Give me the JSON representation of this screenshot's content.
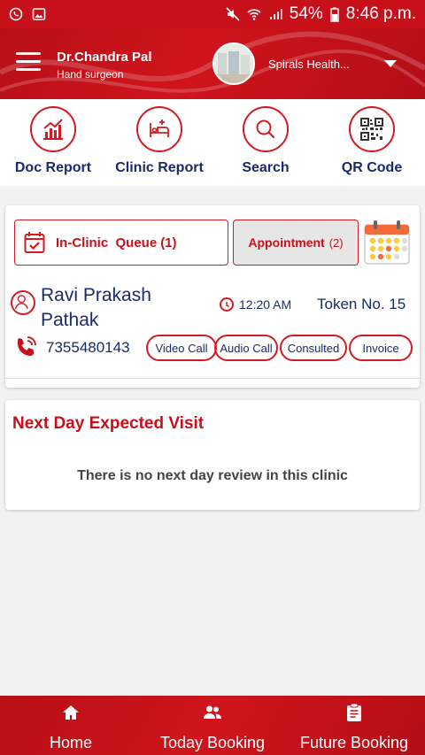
{
  "status_bar": {
    "battery": "54%",
    "time": "8:46 p.m."
  },
  "header": {
    "doctor_name": "Dr.Chandra Pal",
    "doctor_specialty": "Hand surgeon",
    "clinic_name": "Spirals Health..."
  },
  "quick_actions": [
    {
      "label": "Doc Report",
      "icon": "chart-icon"
    },
    {
      "label": "Clinic Report",
      "icon": "bed-icon"
    },
    {
      "label": "Search",
      "icon": "search-icon"
    },
    {
      "label": "QR Code",
      "icon": "qr-code-icon"
    }
  ],
  "queue": {
    "inclinic_label": "In-Clinic  Queue",
    "inclinic_count": "(1)",
    "appointment_label": "Appointment",
    "appointment_count": "(2)",
    "patient": {
      "name": "Ravi Prakash Pathak",
      "time": "12:20 AM",
      "token": "Token No. 15",
      "phone": "7355480143"
    },
    "actions": [
      "Video Call",
      "Audio Call",
      "Consulted",
      "Invoice"
    ]
  },
  "next_day": {
    "title": "Next Day Expected Visit",
    "message": "There is no next day review in this clinic"
  },
  "bottom_nav": [
    {
      "label": "Home",
      "icon": "home-icon"
    },
    {
      "label": "Today Booking",
      "icon": "people-icon"
    },
    {
      "label": "Future Booking",
      "icon": "clipboard-icon"
    }
  ],
  "colors": {
    "primary": "#c8101a",
    "text_dark": "#1b2a6b"
  }
}
